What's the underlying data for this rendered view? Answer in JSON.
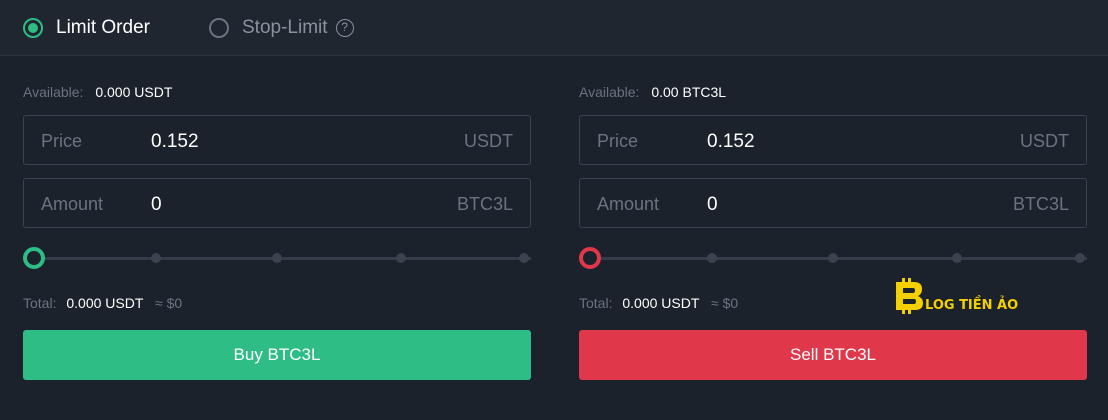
{
  "order_tabs": {
    "limit_label": "Limit Order",
    "stop_label": "Stop-Limit",
    "help_glyph": "?",
    "selected": "Limit Order"
  },
  "buy": {
    "available_label": "Available:",
    "available_value": "0.000 USDT",
    "price_label": "Price",
    "price_value": "0.152",
    "price_unit": "USDT",
    "amount_label": "Amount",
    "amount_value": "0",
    "amount_unit": "BTC3L",
    "slider_percent": 0,
    "total_label": "Total:",
    "total_value": "0.000 USDT",
    "total_approx": "≈ $0",
    "button_label": "Buy BTC3L"
  },
  "sell": {
    "available_label": "Available:",
    "available_value": "0.00 BTC3L",
    "price_label": "Price",
    "price_value": "0.152",
    "price_unit": "USDT",
    "amount_label": "Amount",
    "amount_value": "0",
    "amount_unit": "BTC3L",
    "slider_percent": 0,
    "total_label": "Total:",
    "total_value": "0.000 USDT",
    "total_approx": "≈ $0",
    "button_label": "Sell BTC3L"
  },
  "watermark": {
    "text": "BLOG TIỀN ẢO",
    "color": "#f5d000"
  },
  "colors": {
    "buy": "#2ebd85",
    "sell": "#e0374b",
    "background": "#1c222b"
  },
  "icons": {
    "help": "question-circle-icon",
    "radio_selected": "radio-checked-icon",
    "radio_unselected": "radio-unchecked-icon"
  }
}
